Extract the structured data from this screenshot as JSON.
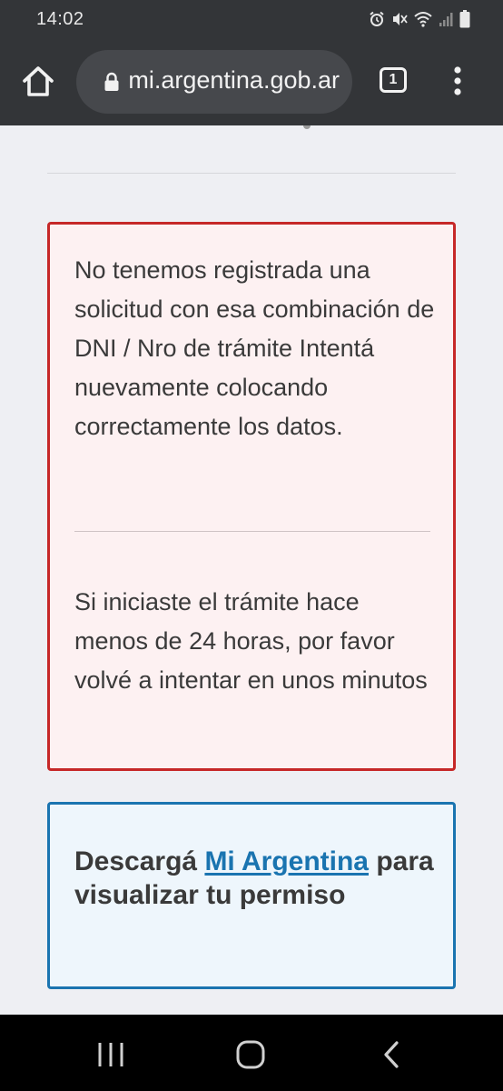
{
  "status_bar": {
    "time": "14:02",
    "icons": [
      "alarm-icon",
      "mute-icon",
      "wifi-icon",
      "signal-icon",
      "battery-icon"
    ]
  },
  "browser": {
    "url": "mi.argentina.gob.ar",
    "tab_count": "1",
    "icons": [
      "home-icon",
      "lock-icon",
      "tabs-icon",
      "more-menu-icon"
    ]
  },
  "error_box": {
    "message": "No tenemos registrada una solicitud con esa combinación de DNI / Nro de trámite Intentá nuevamente colocando correctamente los datos.",
    "hint": "Si iniciaste el trámite hace menos de 24 horas, por favor volvé a intentar en unos minutos"
  },
  "info_box": {
    "prefix": "Descargá ",
    "link_label": "Mi Argentina",
    "suffix": " para visualizar tu permiso"
  },
  "nav_bar": {
    "icons": [
      "recent-apps-icon",
      "home-icon",
      "back-icon"
    ]
  },
  "colors": {
    "chrome": "#333538",
    "error_border": "#c62828",
    "error_bg": "#fdf1f2",
    "info_border": "#1a74b0",
    "info_bg": "#eef6fc",
    "link": "#1a74b0"
  }
}
